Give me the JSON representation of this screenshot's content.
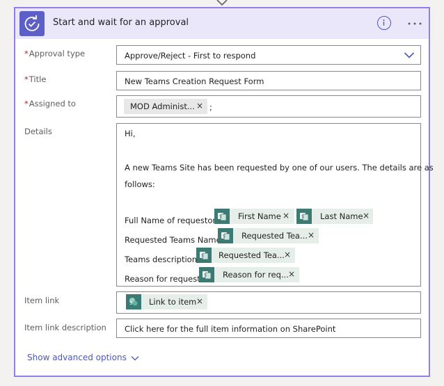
{
  "header": {
    "title": "Start and wait for an approval",
    "icon": "approval-icon",
    "accent": "#5b5fc7",
    "header_bg": "#ebe7fb",
    "border": "#8f7fe6"
  },
  "fields": {
    "approval_type": {
      "label": "Approval type",
      "required": "*",
      "value": "Approve/Reject - First to respond"
    },
    "title": {
      "label": "Title",
      "required": "*",
      "value": "New Teams Creation Request Form"
    },
    "assigned_to": {
      "label": "Assigned to",
      "required": "*",
      "token": "MOD Administ...",
      "separator": ";"
    },
    "details": {
      "label": "Details",
      "greeting": "Hi,",
      "intro_line1": "A new Teams Site has been requested by one of our users. The details are as",
      "intro_line2": "follows:",
      "rows": [
        {
          "label": "Full Name of requestor:",
          "tokens": [
            "First Name",
            "Last Name"
          ]
        },
        {
          "label": "Requested Teams Name:",
          "tokens": [
            "Requested Tea..."
          ]
        },
        {
          "label": "Teams description:",
          "tokens": [
            "Requested Tea..."
          ]
        },
        {
          "label": "Reason for request:",
          "tokens": [
            "Reason for req..."
          ]
        }
      ]
    },
    "item_link": {
      "label": "Item link",
      "token": "Link to item",
      "token_icon": "sharepoint-icon"
    },
    "item_link_description": {
      "label": "Item link description",
      "value": "Click here for the full item information on SharePoint"
    }
  },
  "footer": {
    "show_advanced": "Show advanced options"
  },
  "colors": {
    "dynamic_token_icon": "#3b7b74",
    "link": "#4a56c2",
    "required": "#a4262c"
  }
}
